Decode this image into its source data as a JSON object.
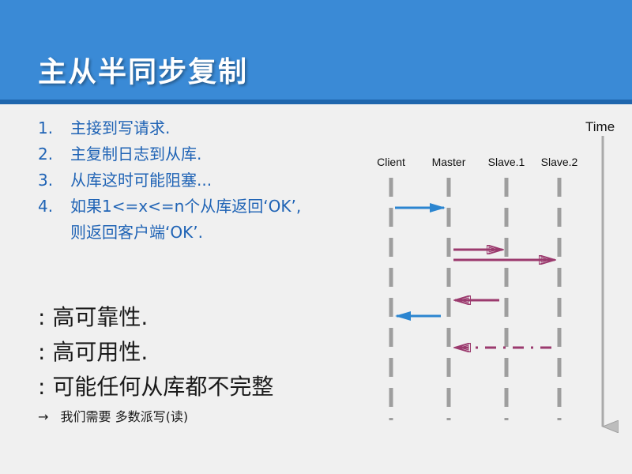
{
  "slide": {
    "title": "主从半同步复制",
    "steps": [
      {
        "num": "1.",
        "text": "主接到写请求."
      },
      {
        "num": "2.",
        "text": "主复制日志到从库."
      },
      {
        "num": "3.",
        "text": "从库这时可能阻塞..."
      },
      {
        "num": "4.",
        "text": "如果1<=x<=n个从库返回‘OK’,"
      },
      {
        "num": "",
        "text": "则返回客户端‘OK’."
      }
    ],
    "properties": [
      ": 高可靠性.",
      ": 高可用性.",
      ": 可能任何从库都不完整"
    ],
    "note": {
      "arrow": "→",
      "text": "我们需要 多数派写(读)"
    }
  },
  "diagram": {
    "time_label": "Time",
    "actors": [
      "Client",
      "Master",
      "Slave.1",
      "Slave.2"
    ],
    "colors": {
      "client_arrow": "#2b85d0",
      "replication_arrow": "#9b3a6e",
      "lifeline": "#9e9e9e",
      "time_axis": "#aaaaaa"
    },
    "messages": [
      {
        "from": "Client",
        "to": "Master",
        "style": "solid",
        "color": "client_arrow"
      },
      {
        "from": "Master",
        "to": "Slave.1",
        "style": "solid",
        "color": "replication_arrow"
      },
      {
        "from": "Master",
        "to": "Slave.2",
        "style": "solid",
        "color": "replication_arrow"
      },
      {
        "from": "Slave.1",
        "to": "Master",
        "style": "solid",
        "color": "replication_arrow"
      },
      {
        "from": "Master",
        "to": "Client",
        "style": "solid",
        "color": "client_arrow"
      },
      {
        "from": "Slave.2",
        "to": "Master",
        "style": "dashdot",
        "color": "replication_arrow"
      }
    ]
  }
}
